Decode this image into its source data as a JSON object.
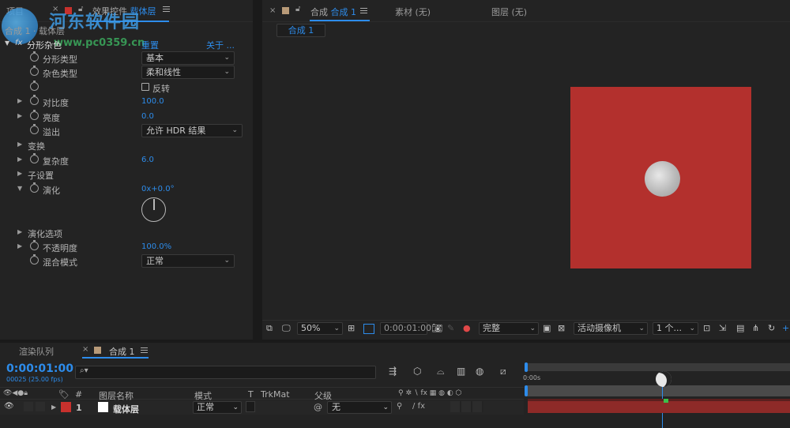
{
  "watermark": {
    "site_cn": "河东软件园",
    "site_url": "www.pc0359.cn"
  },
  "left_panel": {
    "tab_project": "项目",
    "tab_effects": "效果控件",
    "tab_effects_layer": "载体层",
    "subtitle": "合成 1 · 载体层",
    "effect_name": "分形杂色",
    "reset": "重置",
    "about": "关于 ...",
    "props": [
      {
        "label": "分形类型",
        "dropdown": "基本"
      },
      {
        "label": "杂色类型",
        "dropdown": "柔和线性"
      },
      {
        "checkbox_label": "反转"
      },
      {
        "label": "对比度",
        "value": "100.0"
      },
      {
        "label": "亮度",
        "value": "0.0"
      },
      {
        "label": "溢出",
        "dropdown": "允许 HDR 结果"
      },
      {
        "label": "变换"
      },
      {
        "label": "复杂度",
        "value": "6.0"
      },
      {
        "label": "子设置"
      },
      {
        "label": "演化",
        "value": "0x+0.0°"
      },
      {
        "label": "演化选项"
      },
      {
        "label": "不透明度",
        "value": "100.0%"
      },
      {
        "label": "混合模式",
        "dropdown": "正常"
      }
    ]
  },
  "viewer": {
    "tab_comp_prefix": "合成",
    "tab_comp_name": "合成 1",
    "tab_footage": "素材  (无)",
    "tab_layer": "图层  (无)",
    "sub_tab": "合成 1",
    "colors": {
      "solid": "#b3302d",
      "bg": "#232323"
    },
    "toolbar": {
      "zoom": "50%",
      "timecode": "0:00:01:00",
      "resolution": "完整",
      "camera": "活动摄像机",
      "views": "1 个..."
    }
  },
  "timeline": {
    "tab_render": "渲染队列",
    "tab_comp": "合成 1",
    "timecode": "0:00:01:00",
    "frames": "00025 (25.00 fps)",
    "columns": {
      "num": "#",
      "layer_name": "图层名称",
      "mode": "模式",
      "t": "T",
      "trkmat": "TrkMat",
      "parent": "父级"
    },
    "layer": {
      "index": "1",
      "name": "载体层",
      "mode": "正常",
      "parent": "无"
    },
    "ruler_start": "0:00s"
  }
}
